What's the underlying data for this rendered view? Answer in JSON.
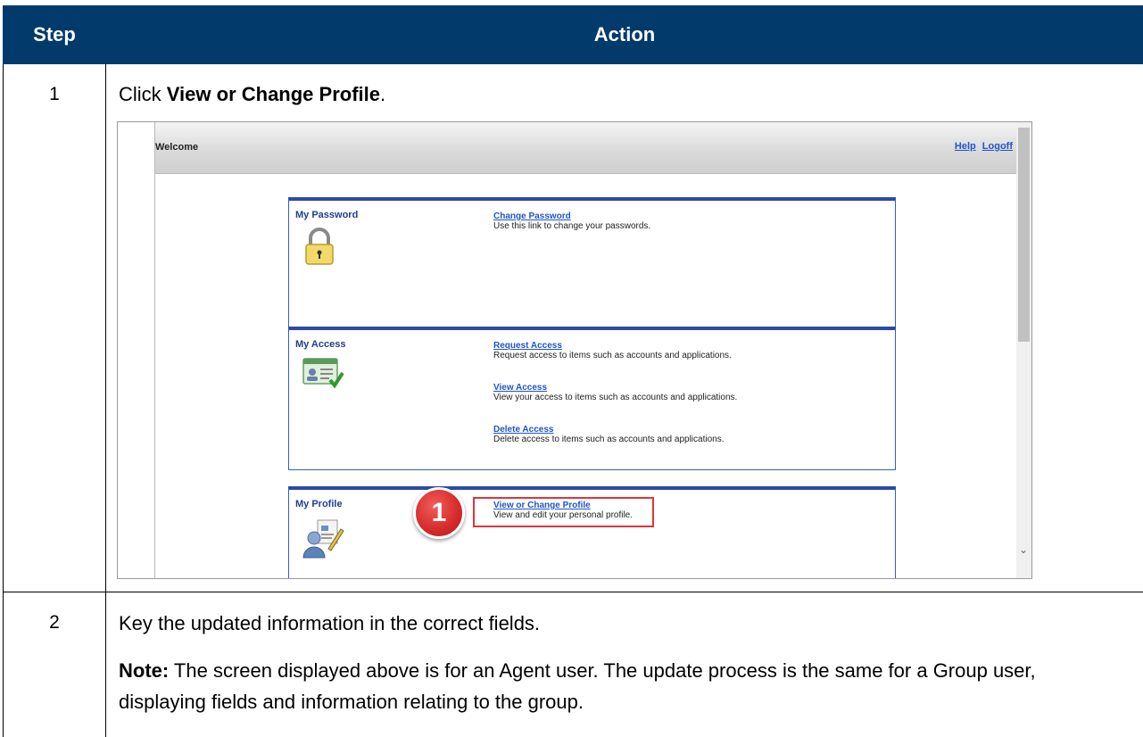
{
  "table": {
    "header_step": "Step",
    "header_action": "Action"
  },
  "rows": [
    {
      "step": "1",
      "instruction_prefix": "Click ",
      "instruction_bold": "View or Change Profile",
      "instruction_suffix": "."
    },
    {
      "step": "2",
      "instruction": "Key the updated information in the correct fields.",
      "note_label": "Note:",
      "note_text": " The screen displayed above is for an Agent user. The update process is the same for a Group user, displaying fields and information relating to the group."
    }
  ],
  "screenshot": {
    "welcome": "Welcome",
    "help_link": "Help",
    "logoff_link": "Logoff",
    "callout_number": "1",
    "panels": {
      "password": {
        "title": "My Password",
        "icon": "padlock-icon",
        "links": [
          {
            "label": "Change Password",
            "desc": "Use this link to change your passwords."
          }
        ]
      },
      "access": {
        "title": "My Access",
        "icon": "access-card-icon",
        "links": [
          {
            "label": "Request Access",
            "desc": "Request access to items such as accounts and applications."
          },
          {
            "label": "View Access",
            "desc": "View your access to items such as accounts and applications."
          },
          {
            "label": "Delete Access",
            "desc": "Delete access to items such as accounts and applications."
          }
        ]
      },
      "profile": {
        "title": "My Profile",
        "icon": "profile-edit-icon",
        "links": [
          {
            "label": "View or Change Profile",
            "desc": "View and edit your personal profile."
          }
        ]
      }
    },
    "colors": {
      "header_bg": "#013A6B",
      "panel_border": "#2C4AA8",
      "link": "#1F54C9",
      "callout": "#D42A2A"
    }
  }
}
